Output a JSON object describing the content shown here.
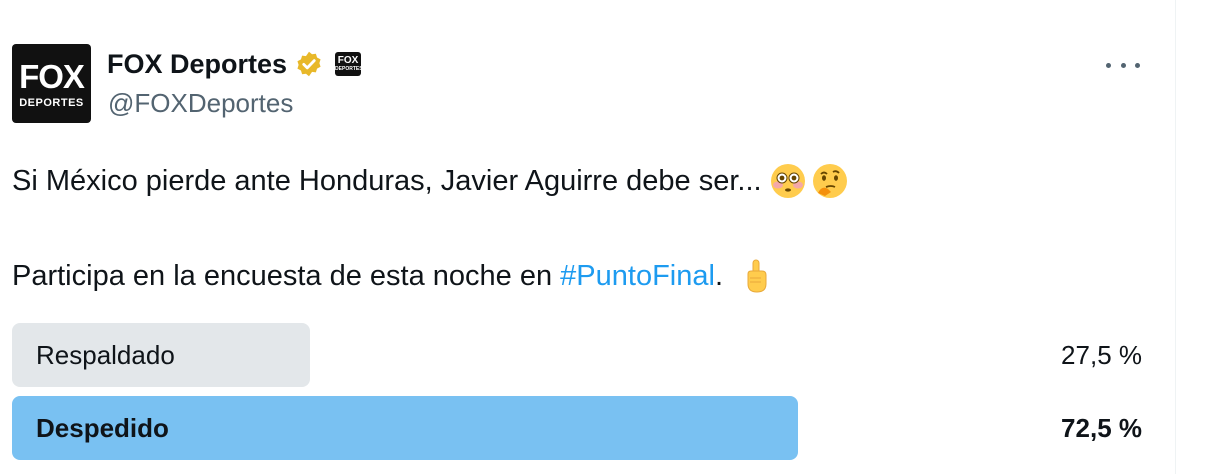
{
  "tweet": {
    "author": {
      "avatar_text_main": "FOX",
      "avatar_text_sub": "DEPORTES",
      "display_name": "FOX Deportes",
      "handle": "@FOXDeportes",
      "verified_color": "#e8b829",
      "affiliate_badge_text_main": "FOX",
      "affiliate_badge_text_sub": "DEPORTES"
    },
    "text_line1": "Si México pierde ante Honduras, Javier Aguirre debe ser...",
    "text_line2_before": "Participa en la encuesta de esta noche en ",
    "hashtag": "#PuntoFinal",
    "text_line2_after": ".",
    "emojis": [
      "flushed-face",
      "thinking-face",
      "pointing-up"
    ]
  },
  "poll": {
    "options": [
      {
        "label": "Respaldado",
        "percent_text": "27,5 %",
        "percent": 27.5,
        "winner": false
      },
      {
        "label": "Despedido",
        "percent_text": "72,5 %",
        "percent": 72.5,
        "winner": true
      }
    ]
  },
  "colors": {
    "hashtag": "#1d9bf0",
    "winner_bar": "#79c1f2",
    "loser_bar": "#e3e7ea",
    "secondary_text": "#536471"
  }
}
